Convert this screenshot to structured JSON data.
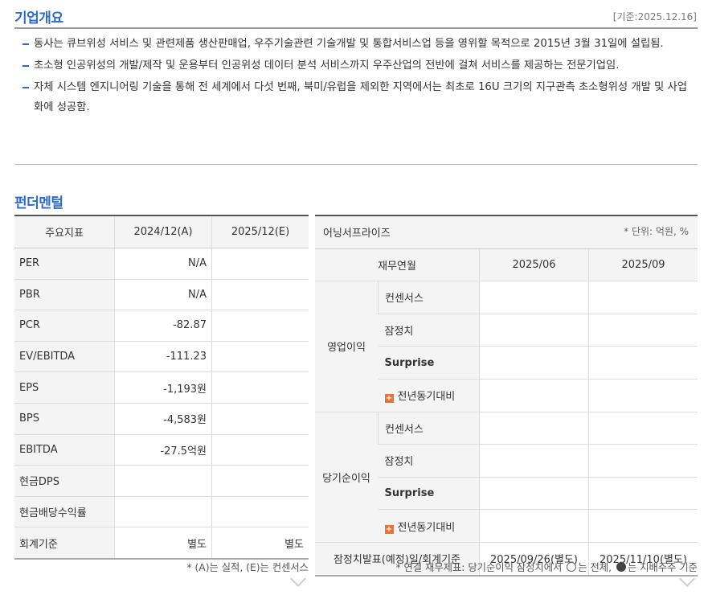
{
  "overview": {
    "title": "기업개요",
    "date": "[기준:2025.12.16]",
    "bullets": [
      "동사는 큐브위성 서비스 및 관련제품 생산판매업, 우주기술관련 기술개발 및 통합서비스업 등을 영위할 목적으로 2015년 3월 31일에 설립됨.",
      "초소형 인공위성의 개발/제작 및 운용부터 인공위성 데이터 분석 서비스까지 우주산업의 전반에 걸쳐 서비스를 제공하는 전문기업임.",
      "자체 시스템 엔지니어링 기술을 통해 전 세계에서 다섯 번째, 북미/유럽을 제외한 지역에서는 최초로 16U 크기의 지구관측 초소형위성 개발 및 사업화에 성공함."
    ]
  },
  "fundamental": {
    "title": "펀더멘털",
    "headers": [
      "주요지표",
      "2024/12(A)",
      "2025/12(E)"
    ],
    "rows": [
      {
        "label": "PER",
        "v1": "N/A",
        "v2": ""
      },
      {
        "label": "PBR",
        "v1": "N/A",
        "v2": ""
      },
      {
        "label": "PCR",
        "v1": "-82.87",
        "v2": ""
      },
      {
        "label": "EV/EBITDA",
        "v1": "-111.23",
        "v2": ""
      },
      {
        "label": "EPS",
        "v1": "-1,193원",
        "v2": ""
      },
      {
        "label": "BPS",
        "v1": "-4,583원",
        "v2": ""
      },
      {
        "label": "EBITDA",
        "v1": "-27.5억원",
        "v2": ""
      },
      {
        "label": "현금DPS",
        "v1": "",
        "v2": ""
      },
      {
        "label": "현금배당수익률",
        "v1": "",
        "v2": ""
      },
      {
        "label": "회계기준",
        "v1": "별도",
        "v2": "별도"
      }
    ],
    "note": "* (A)는 실적, (E)는 컨센서스"
  },
  "earnings": {
    "title": "어닝서프라이즈",
    "unit": "* 단위: 억원, %",
    "header_label": "재무연월",
    "periods": [
      "2025/06",
      "2025/09"
    ],
    "groups": [
      {
        "name": "영업이익",
        "items": [
          "컨센서스",
          "잠정치",
          "Surprise",
          "전년동기대비"
        ]
      },
      {
        "name": "당기순이익",
        "items": [
          "컨센서스",
          "잠정치",
          "Surprise",
          "전년동기대비"
        ]
      }
    ],
    "footer_label": "잠정치발표(예정)일/회계기준",
    "footer_values": [
      "2025/09/26(별도)",
      "2025/11/10(별도)"
    ],
    "note_prefix": "* 연결 재무제표: 당기순이익 잠정치에서",
    "note_mid": "는 전체,",
    "note_end": "는 지배주주 기준"
  }
}
